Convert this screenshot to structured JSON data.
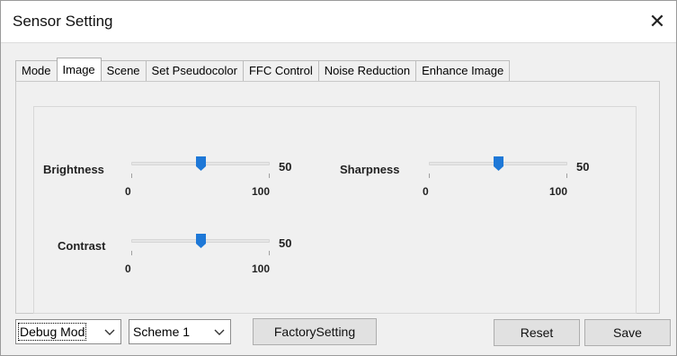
{
  "window": {
    "title": "Sensor Setting",
    "close_label": "✕"
  },
  "tabs": [
    {
      "label": "Mode",
      "active": false
    },
    {
      "label": "Image",
      "active": true
    },
    {
      "label": "Scene",
      "active": false
    },
    {
      "label": "Set Pseudocolor",
      "active": false
    },
    {
      "label": "FFC Control",
      "active": false
    },
    {
      "label": "Noise Reduction",
      "active": false
    },
    {
      "label": "Enhance Image",
      "active": false
    }
  ],
  "sliders": {
    "brightness": {
      "label": "Brightness",
      "value": "50",
      "min": "0",
      "max": "100"
    },
    "sharpness": {
      "label": "Sharpness",
      "value": "50",
      "min": "0",
      "max": "100"
    },
    "contrast": {
      "label": "Contrast",
      "value": "50",
      "min": "0",
      "max": "100"
    }
  },
  "bottom": {
    "mode_select": "Debug Mod",
    "scheme_select": "Scheme 1",
    "factory_button": "FactorySetting",
    "reset_button": "Reset",
    "save_button": "Save"
  },
  "colors": {
    "accent": "#1e78d7",
    "window_bg": "#f0f0f0",
    "button_bg": "#e1e1e1"
  }
}
